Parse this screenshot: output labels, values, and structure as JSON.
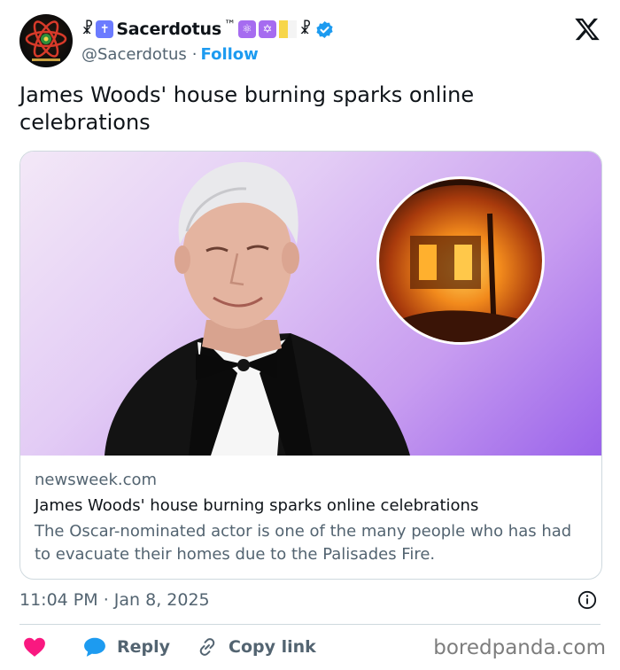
{
  "author": {
    "name": "Sacerdotus",
    "trademark": "™",
    "handle": "@Sacerdotus",
    "separator": "·",
    "follow_label": "Follow",
    "verified": true,
    "icons": [
      "chi-rho-icon",
      "cross-icon",
      "atom-icon",
      "star-of-david-icon",
      "vatican-flag-icon",
      "chi-rho-icon",
      "verified-badge-icon"
    ]
  },
  "tweet": {
    "text": "James Woods' house burning sparks online celebrations"
  },
  "card": {
    "domain": "newsweek.com",
    "title": "James Woods' house burning sparks online celebrations",
    "description": "The Oscar-nominated actor is one of the many people who has had to evacuate their homes due to the Palisades Fire."
  },
  "meta": {
    "time": "11:04 PM",
    "separator": "·",
    "date": "Jan 8, 2025"
  },
  "actions": {
    "reply_label": "Reply",
    "copy_label": "Copy link"
  },
  "watermark": "boredpanda.com",
  "colors": {
    "accent": "#1d9bf0",
    "heart": "#f91880",
    "muted": "#536471",
    "text": "#0f1419",
    "border": "#cfd9de"
  }
}
